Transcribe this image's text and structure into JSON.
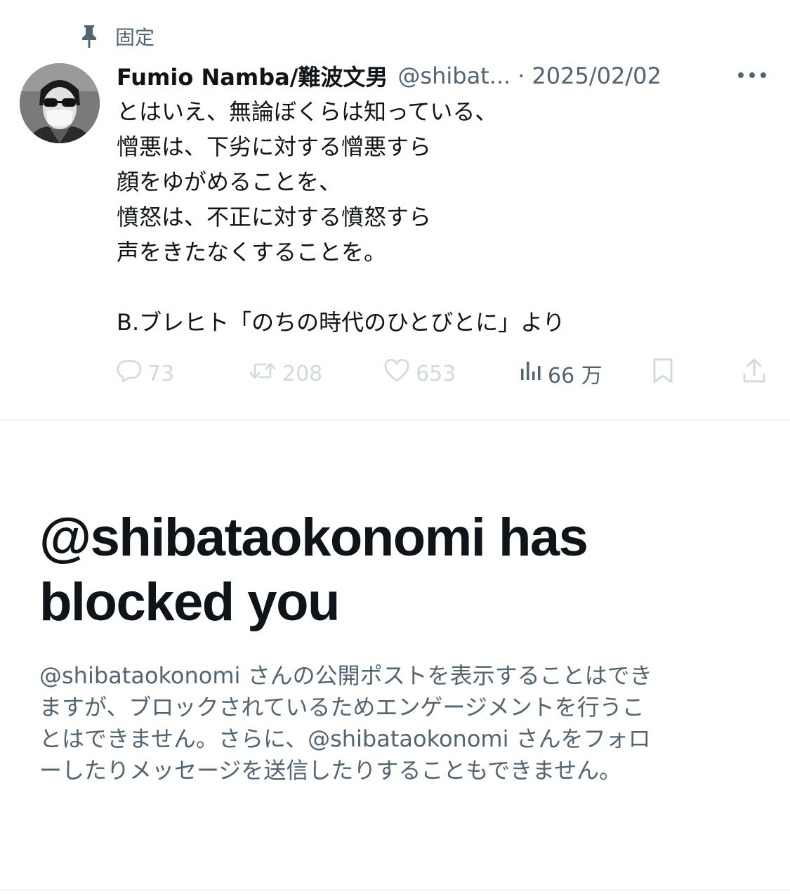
{
  "pinned": {
    "label": "固定",
    "icon": "pin-icon"
  },
  "tweet": {
    "display_name": "Fumio Namba/難波文男",
    "handle": "@shibat...",
    "separator": "·",
    "date": "2025/02/02",
    "more_icon": "more-dots-icon",
    "avatar": "user-avatar",
    "text_lines": [
      "とはいえ、無論ぼくらは知っている、",
      "憎悪は、下劣に対する憎悪すら",
      "顔をゆがめることを、",
      "憤怒は、不正に対する憤怒すら",
      "声をきたなくすることを。",
      "",
      "B.ブレヒト「のちの時代のひとびとに」より"
    ],
    "actions": {
      "replies": "73",
      "retweets": "208",
      "likes": "653",
      "views": "66 万"
    }
  },
  "blocked": {
    "title_lines": [
      "@shibataokonomi has",
      "blocked you"
    ],
    "description_lines": [
      "@shibataokonomi さんの公開ポストを表示することはでき",
      "ますが、ブロックされているためエンゲージメントを行うこ",
      "とはできません。さらに、@shibataokonomi さんをフォロ",
      "ーしたりメッセージを送信したりすることもできません。"
    ]
  },
  "colors": {
    "text_primary": "#0f1419",
    "text_secondary": "#536471",
    "icon_disabled": "#cfd9de",
    "divider": "#eff3f4"
  }
}
